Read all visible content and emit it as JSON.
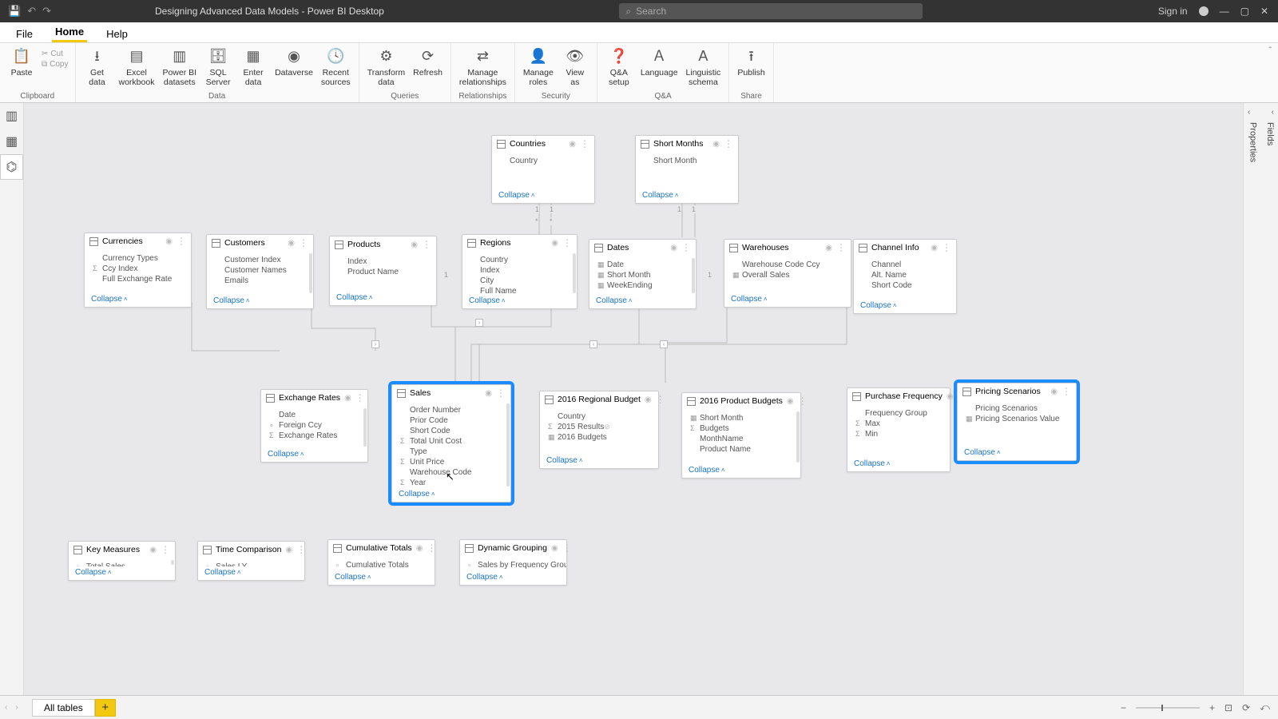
{
  "titlebar": {
    "title": "Designing Advanced Data Models - Power BI Desktop",
    "search_placeholder": "Search",
    "signin": "Sign in"
  },
  "ribbon_tabs": [
    "File",
    "Home",
    "Help"
  ],
  "ribbon": {
    "clipboard": {
      "label": "Clipboard",
      "paste": "Paste",
      "cut": "Cut",
      "copy": "Copy"
    },
    "data": {
      "label": "Data",
      "buttons": [
        "Get\ndata",
        "Excel\nworkbook",
        "Power BI\ndatasets",
        "SQL\nServer",
        "Enter\ndata",
        "Dataverse",
        "Recent\nsources"
      ]
    },
    "queries": {
      "label": "Queries",
      "buttons": [
        "Transform\ndata",
        "Refresh"
      ]
    },
    "relationships": {
      "label": "Relationships",
      "buttons": [
        "Manage\nrelationships"
      ]
    },
    "security": {
      "label": "Security",
      "buttons": [
        "Manage\nroles",
        "View\nas"
      ]
    },
    "qa": {
      "label": "Q&A",
      "buttons": [
        "Q&A\nsetup",
        "Language\n ",
        "Linguistic\nschema"
      ]
    },
    "share": {
      "label": "Share",
      "buttons": [
        "Publish"
      ]
    }
  },
  "right_panes": [
    "Properties",
    "Fields"
  ],
  "collapse_label": "Collapse",
  "tables": {
    "countries": {
      "title": "Countries",
      "fields": [
        {
          "n": "Country"
        }
      ]
    },
    "shortmonths": {
      "title": "Short Months",
      "fields": [
        {
          "n": "Short Month"
        }
      ]
    },
    "currencies": {
      "title": "Currencies",
      "fields": [
        {
          "n": "Currency Types"
        },
        {
          "n": "Ccy Index",
          "s": "Σ"
        },
        {
          "n": "Full Exchange Rate"
        }
      ]
    },
    "customers": {
      "title": "Customers",
      "fields": [
        {
          "n": "Customer Index"
        },
        {
          "n": "Customer Names"
        },
        {
          "n": "Emails"
        }
      ]
    },
    "products": {
      "title": "Products",
      "fields": [
        {
          "n": "Index"
        },
        {
          "n": "Product Name"
        }
      ]
    },
    "regions": {
      "title": "Regions",
      "fields": [
        {
          "n": "Country"
        },
        {
          "n": "Index"
        },
        {
          "n": "City"
        },
        {
          "n": "Full Name"
        }
      ]
    },
    "dates": {
      "title": "Dates",
      "fields": [
        {
          "n": "Date",
          "s": "▦"
        },
        {
          "n": "Short Month",
          "s": "▦"
        },
        {
          "n": "WeekEnding",
          "s": "▦"
        }
      ]
    },
    "warehouses": {
      "title": "Warehouses",
      "fields": [
        {
          "n": "Warehouse Code Ccy"
        },
        {
          "n": "Overall Sales",
          "s": "▦"
        }
      ]
    },
    "channelinfo": {
      "title": "Channel Info",
      "fields": [
        {
          "n": "Channel"
        },
        {
          "n": "Alt. Name"
        },
        {
          "n": "Short Code"
        }
      ]
    },
    "exchangerates": {
      "title": "Exchange Rates",
      "fields": [
        {
          "n": "Date"
        },
        {
          "n": "Foreign Ccy",
          "s": "∘"
        },
        {
          "n": "Exchange Rates",
          "s": "Σ"
        }
      ]
    },
    "sales": {
      "title": "Sales",
      "fields": [
        {
          "n": "Order Number"
        },
        {
          "n": "Prior Code"
        },
        {
          "n": "Short Code"
        },
        {
          "n": "Total Unit Cost",
          "s": "Σ"
        },
        {
          "n": "Type"
        },
        {
          "n": "Unit Price",
          "s": "Σ"
        },
        {
          "n": "Warehouse Code"
        },
        {
          "n": "Year",
          "s": "Σ"
        }
      ]
    },
    "regionalbudget": {
      "title": "2016 Regional Budget",
      "fields": [
        {
          "n": "Country"
        },
        {
          "n": "2015 Results",
          "s": "Σ",
          "h": true
        },
        {
          "n": "2016 Budgets",
          "s": "▦"
        }
      ]
    },
    "productbudgets": {
      "title": "2016 Product Budgets",
      "fields": [
        {
          "n": "Short Month",
          "s": "▦"
        },
        {
          "n": "Budgets",
          "s": "Σ"
        },
        {
          "n": "MonthName"
        },
        {
          "n": "Product Name"
        }
      ]
    },
    "purchasefreq": {
      "title": "Purchase Frequency",
      "fields": [
        {
          "n": "Frequency Group"
        },
        {
          "n": "Max",
          "s": "Σ"
        },
        {
          "n": "Min",
          "s": "Σ"
        }
      ]
    },
    "pricingscenarios": {
      "title": "Pricing Scenarios",
      "fields": [
        {
          "n": "Pricing Scenarios"
        },
        {
          "n": "Pricing Scenarios Value",
          "s": "▦"
        }
      ]
    },
    "keymeasures": {
      "title": "Key Measures",
      "fields": [
        {
          "n": "Total Sales",
          "s": "▫"
        }
      ]
    },
    "timecomp": {
      "title": "Time Comparison",
      "fields": [
        {
          "n": "Sales LY",
          "s": "▫"
        }
      ]
    },
    "cumtotals": {
      "title": "Cumulative Totals",
      "fields": [
        {
          "n": "Cumulative Totals",
          "s": "▫"
        }
      ]
    },
    "dyngroup": {
      "title": "Dynamic Grouping",
      "fields": [
        {
          "n": "Sales by Frequency Group",
          "s": "▫"
        }
      ]
    }
  },
  "status": {
    "tab": "All tables"
  }
}
